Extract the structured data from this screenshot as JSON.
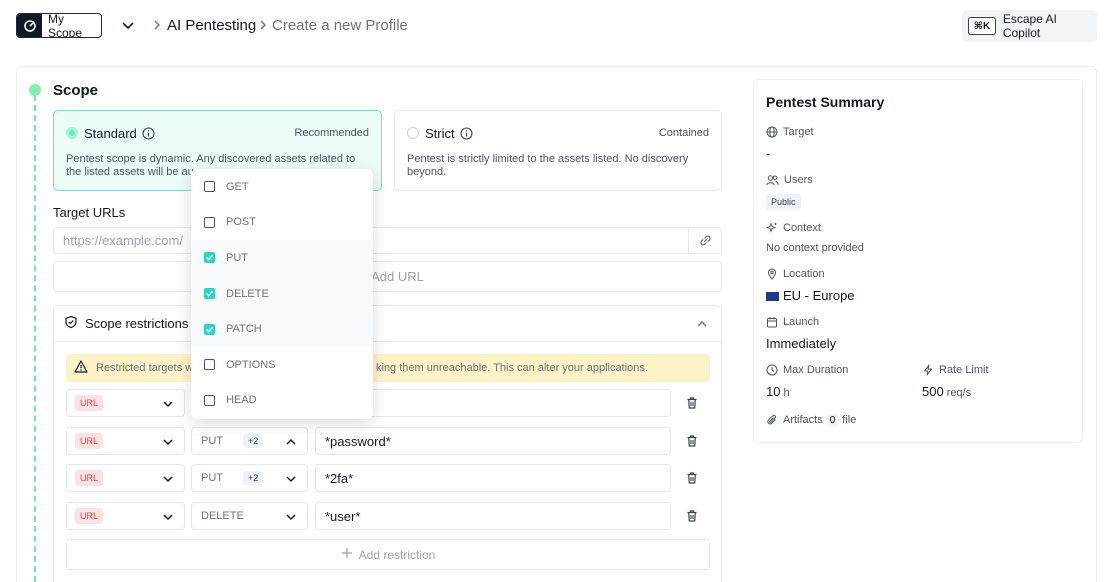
{
  "header": {
    "scope_label": "My Scope",
    "breadcrumb_main": "AI Pentesting",
    "breadcrumb_current": "Create a new Profile",
    "copilot_shortcut": "⌘K",
    "copilot_label": "Escape AI Copilot"
  },
  "scope": {
    "title": "Scope",
    "standard": {
      "title": "Standard",
      "tag": "Recommended",
      "description": "Pentest scope is dynamic. Any discovered assets related to the listed assets will be au"
    },
    "strict": {
      "title": "Strict",
      "tag": "Contained",
      "description": "Pentest is strictly limited to the assets listed. No discovery beyond."
    }
  },
  "target": {
    "label": "Target URLs",
    "placeholder": "https://example.com/",
    "add_url": "Add URL"
  },
  "restrictions": {
    "title": "Scope restrictions",
    "warning_left": "Restricted targets wi",
    "warning_right": "king them unreachable. This can alter your applications.",
    "rows": [
      {
        "type": "URL",
        "method": "",
        "extra": "",
        "pattern": ""
      },
      {
        "type": "URL",
        "method": "PUT",
        "extra": "+2",
        "pattern": "*password*"
      },
      {
        "type": "URL",
        "method": "PUT",
        "extra": "+2",
        "pattern": "*2fa*"
      },
      {
        "type": "URL",
        "method": "DELETE",
        "extra": "",
        "pattern": "*user*"
      }
    ],
    "add_restriction": "Add restriction"
  },
  "methods_dropdown": [
    {
      "label": "GET",
      "checked": false
    },
    {
      "label": "POST",
      "checked": false
    },
    {
      "label": "PUT",
      "checked": true
    },
    {
      "label": "DELETE",
      "checked": true
    },
    {
      "label": "PATCH",
      "checked": true
    },
    {
      "label": "OPTIONS",
      "checked": false
    },
    {
      "label": "HEAD",
      "checked": false
    }
  ],
  "summary": {
    "title": "Pentest Summary",
    "target_label": "Target",
    "target_value": "-",
    "users_label": "Users",
    "users_value": "Public",
    "context_label": "Context",
    "context_value": "No context provided",
    "location_label": "Location",
    "location_value": "EU - Europe",
    "launch_label": "Launch",
    "launch_value": "Immediately",
    "max_duration_label": "Max Duration",
    "max_duration_value": "10",
    "max_duration_unit": "h",
    "rate_limit_label": "Rate Limit",
    "rate_limit_value": "500",
    "rate_limit_unit": "req/s",
    "artifacts_label": "Artifacts",
    "artifacts_count": "0",
    "artifacts_unit": "file"
  },
  "colors": {
    "accent": "#2dd4bf",
    "standard_bg": "#ecfdf8",
    "warning_bg": "#fef3c7",
    "url_badge": "#ef4444"
  }
}
